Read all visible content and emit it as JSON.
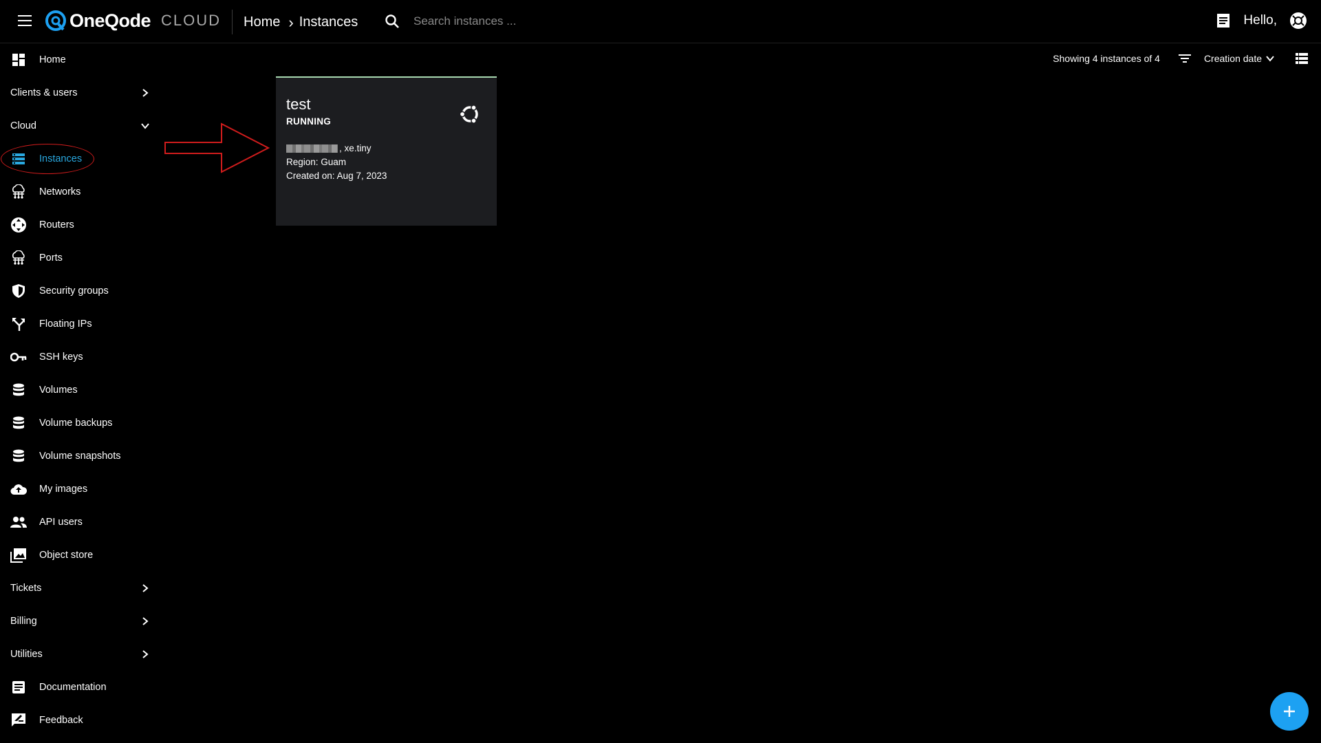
{
  "header": {
    "logo_text": "OneQode",
    "logo_suffix": "CLOUD",
    "breadcrumb": [
      "Home",
      "Instances"
    ],
    "search_placeholder": "Search instances ...",
    "greeting": "Hello,"
  },
  "sidebar": {
    "items": [
      {
        "label": "Home",
        "icon": "dashboard-icon"
      },
      {
        "label": "Clients & users",
        "section": true,
        "chevron": "right"
      },
      {
        "label": "Cloud",
        "section": true,
        "chevron": "down"
      },
      {
        "label": "Instances",
        "icon": "instances-icon",
        "active": true
      },
      {
        "label": "Networks",
        "icon": "networks-icon"
      },
      {
        "label": "Routers",
        "icon": "routers-icon"
      },
      {
        "label": "Ports",
        "icon": "ports-icon"
      },
      {
        "label": "Security groups",
        "icon": "shield-icon"
      },
      {
        "label": "Floating IPs",
        "icon": "floating-ip-icon"
      },
      {
        "label": "SSH keys",
        "icon": "key-icon"
      },
      {
        "label": "Volumes",
        "icon": "database-icon"
      },
      {
        "label": "Volume backups",
        "icon": "database-icon"
      },
      {
        "label": "Volume snapshots",
        "icon": "database-icon"
      },
      {
        "label": "My images",
        "icon": "cloud-upload-icon"
      },
      {
        "label": "API users",
        "icon": "users-icon"
      },
      {
        "label": "Object store",
        "icon": "images-icon"
      },
      {
        "label": "Tickets",
        "section": true,
        "chevron": "right"
      },
      {
        "label": "Billing",
        "section": true,
        "chevron": "right"
      },
      {
        "label": "Utilities",
        "section": true,
        "chevron": "right"
      },
      {
        "label": "Documentation",
        "icon": "document-icon"
      },
      {
        "label": "Feedback",
        "icon": "feedback-icon"
      }
    ]
  },
  "toolbar": {
    "count_text": "Showing 4 instances of 4",
    "sort_label": "Creation date"
  },
  "instances": [
    {
      "name": "test",
      "status": "RUNNING",
      "flavor": ", xe.tiny",
      "region": "Region: Guam",
      "created": "Created on: Aug 7, 2023",
      "os_icon": "ubuntu-icon"
    }
  ],
  "colors": {
    "background": "#000000",
    "accent": "#29a8e0",
    "card": "#1c1d20",
    "card_top_border": "#a8d8b0",
    "fab": "#1da1f2",
    "annotation": "#d01c1c"
  }
}
